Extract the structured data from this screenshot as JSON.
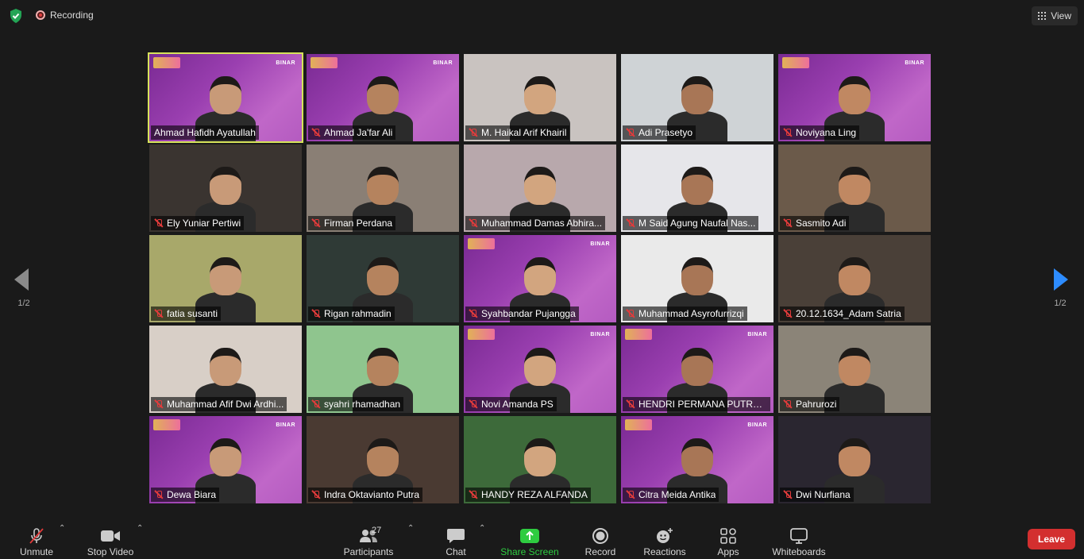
{
  "topbar": {
    "recording_label": "Recording",
    "view_label": "View"
  },
  "navigation": {
    "left_page": "1/2",
    "right_page": "1/2"
  },
  "participants": [
    {
      "name": "Ahmad Hafidh Ayatullah",
      "muted": false,
      "active": true,
      "bg": "purple"
    },
    {
      "name": "Ahmad Ja'far Ali",
      "muted": true,
      "bg": "purple"
    },
    {
      "name": "M. Haikal Arif Khairil",
      "muted": true,
      "bg": "#c9c3c0"
    },
    {
      "name": "Adi Prasetyo",
      "muted": true,
      "bg": "#cfd3d6"
    },
    {
      "name": "Noviyana Ling",
      "muted": true,
      "bg": "purple"
    },
    {
      "name": "Ely Yuniar Pertiwi",
      "muted": true,
      "bg": "#3a3430"
    },
    {
      "name": "Firman Perdana",
      "muted": true,
      "bg": "#8a7f75"
    },
    {
      "name": "Muhammad Damas Abhira...",
      "muted": true,
      "bg": "#b8a8ac"
    },
    {
      "name": "M Said Agung Naufal Nas...",
      "muted": true,
      "bg": "#e6e6ea"
    },
    {
      "name": "Sasmito Adi",
      "muted": true,
      "bg": "#6b5a4a"
    },
    {
      "name": "fatia susanti",
      "muted": true,
      "bg": "#a8a86a"
    },
    {
      "name": "Rigan rahmadin",
      "muted": true,
      "bg": "#2f3a36"
    },
    {
      "name": "Syahbandar Pujangga",
      "muted": true,
      "bg": "purple"
    },
    {
      "name": "Muhammad Asyrofurrizqi",
      "muted": true,
      "bg": "#eaeaea"
    },
    {
      "name": "20.12.1634_Adam Satria",
      "muted": true,
      "bg": "#4a4038"
    },
    {
      "name": "Muhammad Afif Dwi Ardhi...",
      "muted": true,
      "bg": "#d8cfc7"
    },
    {
      "name": "syahri rhamadhan",
      "muted": true,
      "bg": "#8fc58e"
    },
    {
      "name": "Novi Amanda PS",
      "muted": true,
      "bg": "purple"
    },
    {
      "name": "HENDRI PERMANA PUTRA ...",
      "muted": true,
      "bg": "purple"
    },
    {
      "name": "Pahrurozi",
      "muted": true,
      "bg": "#8b8478"
    },
    {
      "name": "Dewa Biara",
      "muted": true,
      "bg": "purple"
    },
    {
      "name": "Indra Oktavianto Putra",
      "muted": true,
      "bg": "#4a3a32"
    },
    {
      "name": "HANDY REZA ALFANDA",
      "muted": true,
      "bg": "#3d6a3a"
    },
    {
      "name": "Citra Meida Antika",
      "muted": true,
      "bg": "purple"
    },
    {
      "name": "Dwi Nurfiana",
      "muted": true,
      "bg": "#2a2630"
    }
  ],
  "toolbar": {
    "unmute_label": "Unmute",
    "stop_video_label": "Stop Video",
    "participants_label": "Participants",
    "participants_count": "27",
    "chat_label": "Chat",
    "share_screen_label": "Share Screen",
    "record_label": "Record",
    "reactions_label": "Reactions",
    "apps_label": "Apps",
    "whiteboards_label": "Whiteboards",
    "leave_label": "Leave"
  },
  "brand_text": "BINAR",
  "colors": {
    "active_speaker": "#d6e35a",
    "share_green": "#2ecc40",
    "leave_red": "#d32f2f",
    "nav_blue": "#2d8cff"
  }
}
